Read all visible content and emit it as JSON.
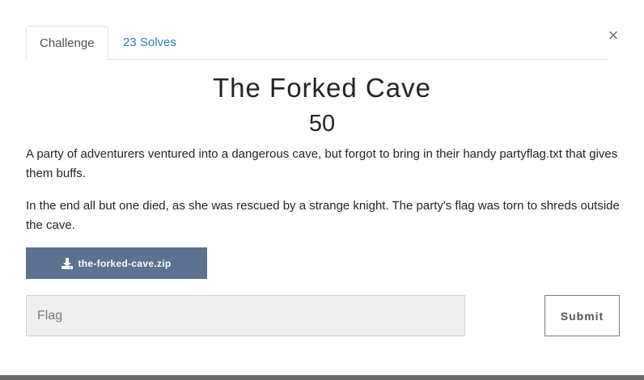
{
  "tabs": [
    {
      "label": "Challenge",
      "active": true
    },
    {
      "label": "23 Solves",
      "active": false
    }
  ],
  "close_label": "×",
  "challenge": {
    "name": "The Forked Cave",
    "value": "50",
    "description": [
      "A party of adventurers ventured into a dangerous cave, but forgot to bring in their handy partyflag.txt that gives them buffs.",
      "In the end all but one died, as she was rescued by a strange knight. The party's flag was torn to shreds outside the cave."
    ],
    "file": {
      "name": "the-forked-cave.zip",
      "icon": "download-icon"
    }
  },
  "form": {
    "flag_placeholder": "Flag",
    "flag_value": "",
    "submit_label": "Submit"
  },
  "colors": {
    "download_button": "#5b7290",
    "tab_link": "#337ab7",
    "input_bg": "#efefef"
  }
}
